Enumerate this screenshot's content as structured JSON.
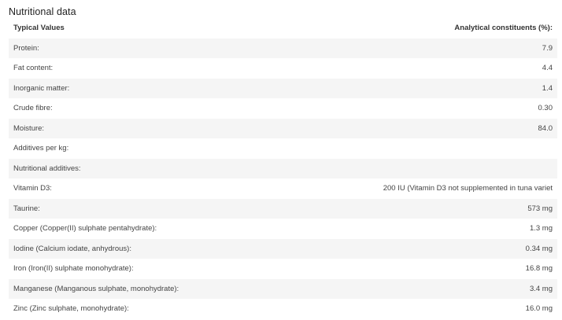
{
  "section": {
    "title": "Nutritional data"
  },
  "table": {
    "headers": {
      "label": "Typical Values",
      "value": "Analytical constituents (%):"
    },
    "rows": [
      {
        "label": "Protein:",
        "value": "7.9"
      },
      {
        "label": "Fat content:",
        "value": "4.4"
      },
      {
        "label": "Inorganic matter:",
        "value": "1.4"
      },
      {
        "label": "Crude fibre:",
        "value": "0.30"
      },
      {
        "label": "Moisture:",
        "value": "84.0"
      },
      {
        "label": "Additives per kg:",
        "value": ""
      },
      {
        "label": "Nutritional additives:",
        "value": ""
      },
      {
        "label": "Vitamin D3:",
        "value": "200 IU (Vitamin D3 not supplemented in tuna variet"
      },
      {
        "label": "Taurine:",
        "value": "573 mg"
      },
      {
        "label": "Copper (Copper(II) sulphate pentahydrate):",
        "value": "1.3 mg"
      },
      {
        "label": "Iodine (Calcium iodate, anhydrous):",
        "value": "0.34 mg"
      },
      {
        "label": "Iron (Iron(II) sulphate monohydrate):",
        "value": "16.8 mg"
      },
      {
        "label": "Manganese (Manganous sulphate, monohydrate):",
        "value": "3.4 mg"
      },
      {
        "label": "Zinc (Zinc sulphate, monohydrate):",
        "value": "16.0 mg"
      }
    ]
  }
}
